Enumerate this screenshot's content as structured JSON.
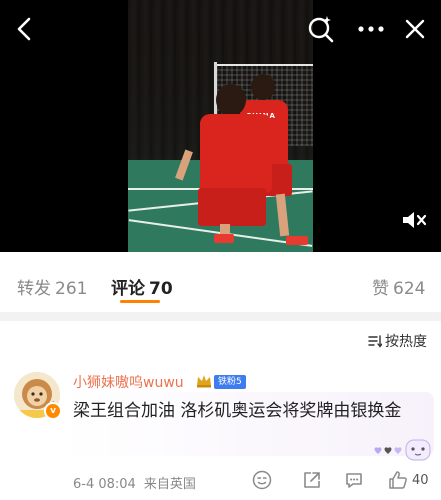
{
  "video": {
    "jersey_text": "CHINA"
  },
  "top_bar": {
    "back_icon": "chevron-left-icon",
    "search_icon": "search-sparkle-icon",
    "more_icon": "more-dots-icon",
    "close_icon": "close-icon",
    "mute_icon": "speaker-muted-icon"
  },
  "tabs": [
    {
      "label": "转发",
      "count": "261"
    },
    {
      "label": "评论",
      "count": "70"
    },
    {
      "label": "赞",
      "count": "624"
    }
  ],
  "sort": {
    "label": "按热度"
  },
  "comment": {
    "username": "小狮妹嗷呜wuwu",
    "fan_badge": "铁粉5",
    "text": "梁王组合加油  洛杉矶奥运会将奖牌由银换金",
    "date": "6-4 08:04",
    "location": "来自英国",
    "like_count": "40"
  },
  "colors": {
    "accent": "#ff8200",
    "username": "#eb7350",
    "badge": "#3f7cf0"
  }
}
